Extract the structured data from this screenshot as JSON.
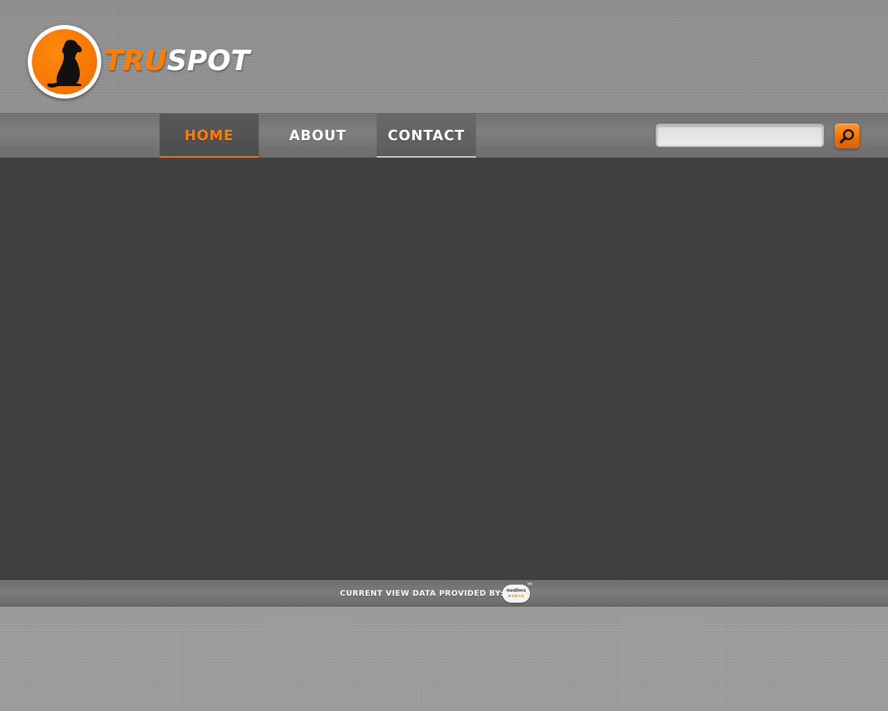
{
  "brand": {
    "name_part1": "TRU",
    "name_part2": "SPOT",
    "accent_color": "#ff7d00",
    "logo_icon": "sitting-dog-icon"
  },
  "nav": {
    "items": [
      {
        "label": "HOME",
        "active": true
      },
      {
        "label": "ABOUT",
        "active": false
      },
      {
        "label": "CONTACT",
        "active": false
      }
    ]
  },
  "search": {
    "value": "",
    "placeholder": "",
    "button_icon": "magnifier-icon"
  },
  "footer": {
    "text": "CURRENT VIEW DATA PROVIDED BY:",
    "provider_logo": {
      "name": "nuuDocs",
      "sub": "MOBILE",
      "tm": "TM"
    }
  },
  "colors": {
    "background": "#9a9a9a",
    "navbar": "#747474",
    "content": "#404040",
    "accent": "#ff7d00",
    "text": "#ffffff"
  }
}
